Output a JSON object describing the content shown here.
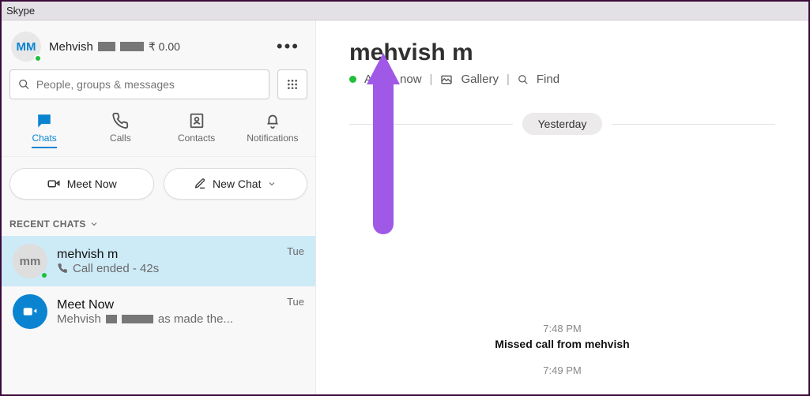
{
  "titlebar": "Skype",
  "user": {
    "initials": "MM",
    "name": "Mehvish",
    "balance": "₹ 0.00"
  },
  "search": {
    "placeholder": "People, groups & messages"
  },
  "tabs": {
    "chats": "Chats",
    "calls": "Calls",
    "contacts": "Contacts",
    "notifications": "Notifications"
  },
  "actions": {
    "meet_now": "Meet Now",
    "new_chat": "New Chat"
  },
  "recent_header": "RECENT CHATS",
  "chats": [
    {
      "initials": "mm",
      "name": "mehvish m",
      "subtitle": "Call ended - 42s",
      "time": "Tue"
    },
    {
      "name": "Meet Now",
      "subtitle_prefix": "Mehvish ",
      "subtitle_suffix": "as made the...",
      "time": "Tue"
    }
  ],
  "conversation": {
    "name": "mehvish m",
    "status_prefix": "A",
    "status_suffix": "e now",
    "gallery": "Gallery",
    "find": "Find",
    "day": "Yesterday",
    "events": [
      {
        "time": "7:48 PM",
        "text": "Missed call from mehvish"
      },
      {
        "time": "7:49 PM"
      }
    ]
  }
}
